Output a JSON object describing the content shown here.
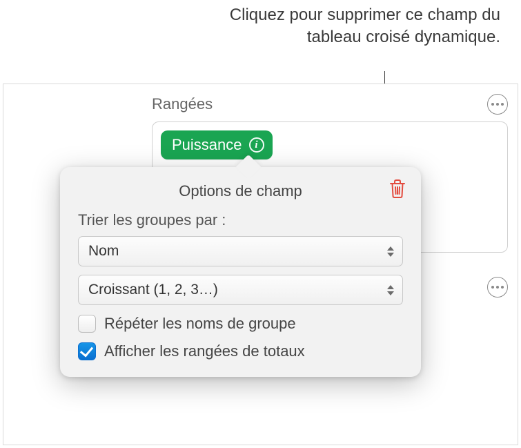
{
  "callout_text": "Cliquez pour supprimer ce champ du tableau croisé dynamique.",
  "section": {
    "label": "Rangées",
    "field_pill": "Puissance"
  },
  "popover": {
    "title": "Options de champ",
    "sort_label": "Trier les groupes par :",
    "sort_by_value": "Nom",
    "sort_order_value": "Croissant (1, 2, 3…)",
    "repeat_label": "Répéter les noms de groupe",
    "totals_label": "Afficher les rangées de totaux"
  },
  "icons": {
    "trash": "trash-icon",
    "more": "more-icon",
    "info": "info-icon",
    "stepper": "stepper-icon"
  }
}
